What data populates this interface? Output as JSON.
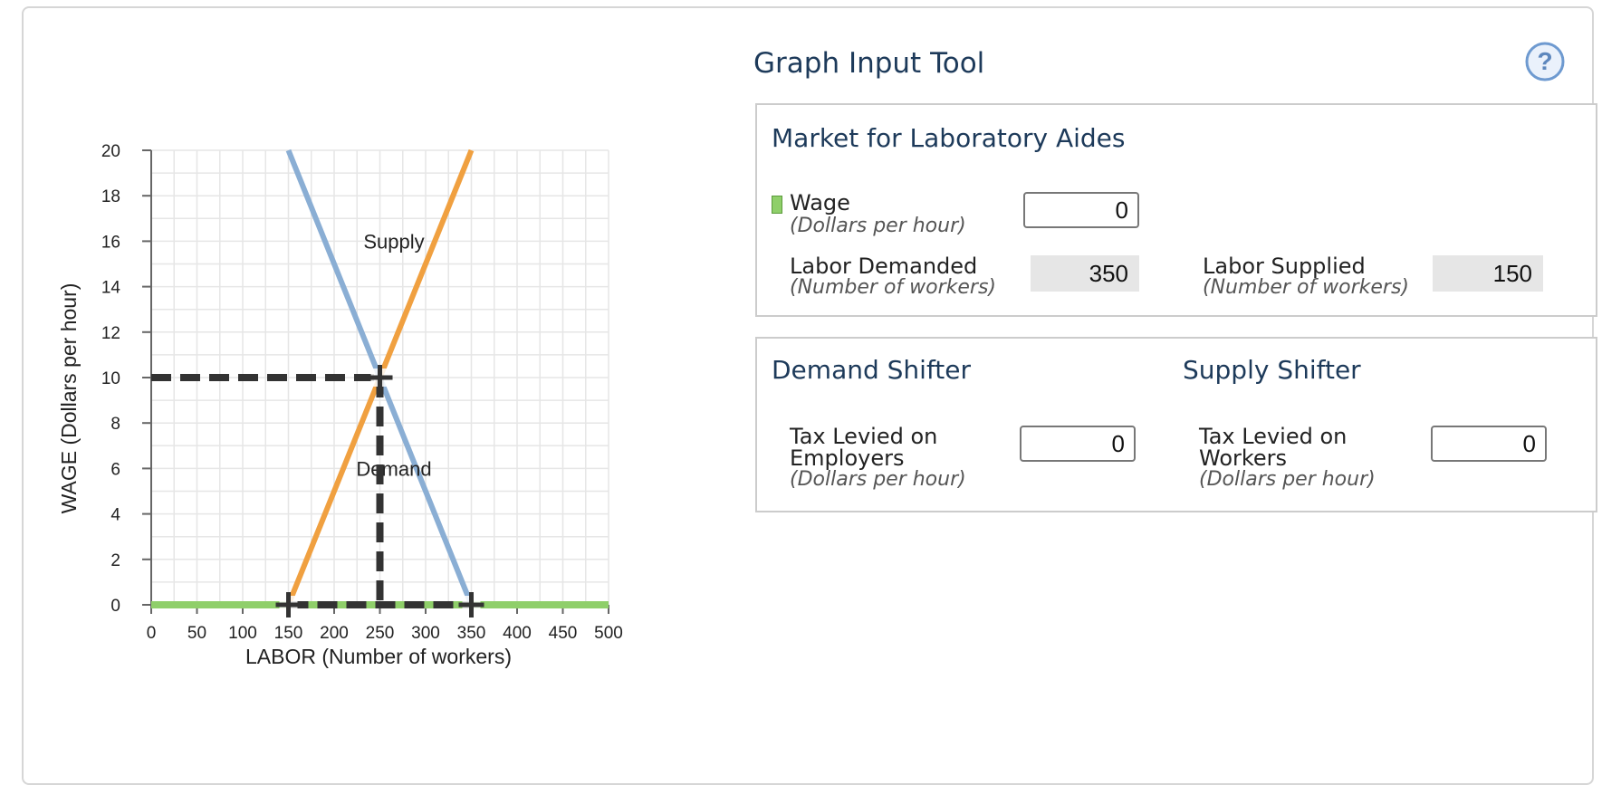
{
  "tool": {
    "title": "Graph Input Tool",
    "help_icon": "question-circle-icon"
  },
  "market_panel": {
    "heading": "Market for Laboratory Aides",
    "wage": {
      "label": "Wage",
      "sub": "(Dollars per hour)",
      "value": "0",
      "swatch_color": "#8fcf6a"
    },
    "labor_demanded": {
      "label": "Labor Demanded",
      "sub": "(Number of workers)",
      "value": "350"
    },
    "labor_supplied": {
      "label": "Labor Supplied",
      "sub": "(Number of workers)",
      "value": "150"
    }
  },
  "shifter_panel": {
    "demand": {
      "heading": "Demand Shifter",
      "label_line1": "Tax Levied on",
      "label_line2": "Employers",
      "sub": "(Dollars per hour)",
      "value": "0"
    },
    "supply": {
      "heading": "Supply Shifter",
      "label_line1": "Tax Levied on",
      "label_line2": "Workers",
      "sub": "(Dollars per hour)",
      "value": "0"
    }
  },
  "chart_data": {
    "type": "line",
    "xlabel": "LABOR (Number of workers)",
    "ylabel": "WAGE (Dollars per hour)",
    "xlim": [
      0,
      500
    ],
    "ylim": [
      0,
      20
    ],
    "xticks": [
      0,
      50,
      100,
      150,
      200,
      250,
      300,
      350,
      400,
      450,
      500
    ],
    "yticks": [
      0,
      2,
      4,
      6,
      8,
      10,
      12,
      14,
      16,
      18,
      20
    ],
    "grid": true,
    "series": [
      {
        "name": "Supply",
        "color": "#f0a040",
        "points": [
          [
            150,
            0
          ],
          [
            350,
            20
          ]
        ],
        "label_at": [
          300,
          16
        ]
      },
      {
        "name": "Demand",
        "color": "#8aaed4",
        "points": [
          [
            150,
            20
          ],
          [
            350,
            0
          ]
        ],
        "label_at": [
          300,
          6
        ]
      }
    ],
    "equilibrium": {
      "x": 250,
      "y": 10
    },
    "wage_line": {
      "y": 0,
      "color": "#8fcf6a"
    },
    "markers": [
      [
        150,
        0
      ],
      [
        350,
        0
      ],
      [
        250,
        10
      ]
    ],
    "marker_color": "#333333"
  }
}
